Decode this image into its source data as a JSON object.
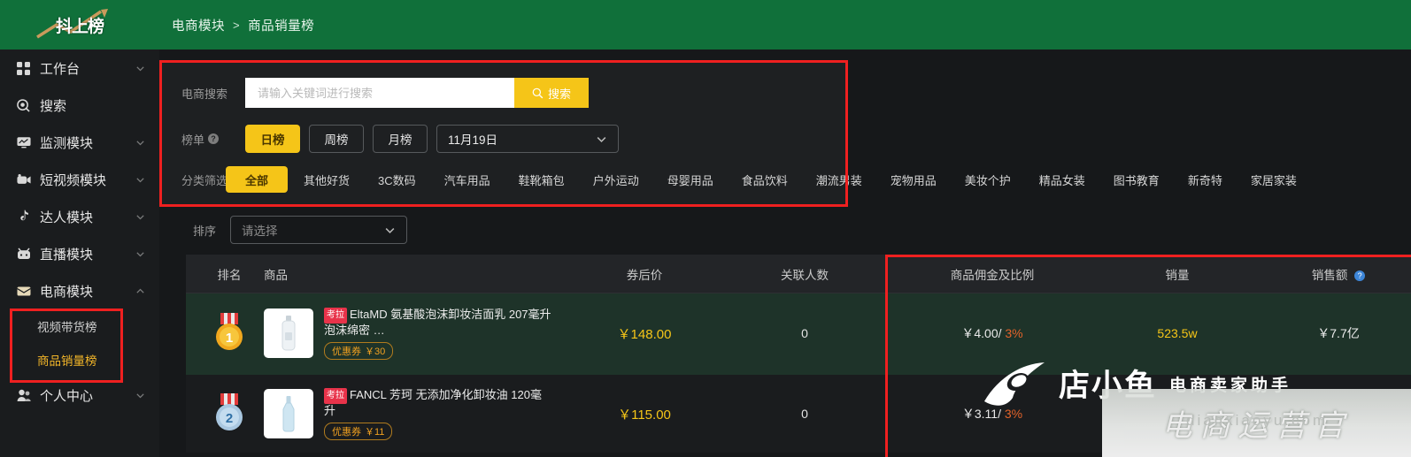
{
  "header": {
    "logo_text": "抖上榜",
    "logo_icon": "rising-arrow-icon",
    "breadcrumb_root": "电商模块",
    "breadcrumb_sep": ">",
    "breadcrumb_current": "商品销量榜"
  },
  "sidebar": {
    "items": [
      {
        "label": "工作台",
        "icon": "grid-icon",
        "chevron": "down"
      },
      {
        "label": "搜索",
        "icon": "search-icon",
        "chevron": ""
      },
      {
        "label": "监测模块",
        "icon": "monitor-icon",
        "chevron": "down"
      },
      {
        "label": "短视频模块",
        "icon": "video-icon",
        "chevron": "down"
      },
      {
        "label": "达人模块",
        "icon": "tiktok-note-icon",
        "chevron": "down"
      },
      {
        "label": "直播模块",
        "icon": "live-icon",
        "chevron": "down"
      },
      {
        "label": "电商模块",
        "icon": "shop-icon",
        "chevron": "up"
      }
    ],
    "sub_items": [
      {
        "label": "视频带货榜",
        "active": false
      },
      {
        "label": "商品销量榜",
        "active": true
      }
    ],
    "footer_item": {
      "label": "个人中心",
      "icon": "user-icon",
      "chevron": "down"
    }
  },
  "filters": {
    "search_label": "电商搜索",
    "search_placeholder": "请输入关键词进行搜索",
    "search_value": "",
    "search_button": "搜索",
    "search_icon": "magnifier-icon",
    "rank_label": "榜单",
    "rank_help_icon": "question-mark-icon",
    "rank_options": [
      {
        "label": "日榜",
        "selected": true
      },
      {
        "label": "周榜",
        "selected": false
      },
      {
        "label": "月榜",
        "selected": false
      }
    ],
    "date_value": "11月19日",
    "date_icon": "chevron-down-icon",
    "category_label": "分类筛选",
    "categories": [
      {
        "label": "全部",
        "selected": true
      },
      {
        "label": "其他好货",
        "selected": false
      },
      {
        "label": "3C数码",
        "selected": false
      },
      {
        "label": "汽车用品",
        "selected": false
      },
      {
        "label": "鞋靴箱包",
        "selected": false
      },
      {
        "label": "户外运动",
        "selected": false
      },
      {
        "label": "母婴用品",
        "selected": false
      },
      {
        "label": "食品饮料",
        "selected": false
      },
      {
        "label": "潮流男装",
        "selected": false
      },
      {
        "label": "宠物用品",
        "selected": false
      },
      {
        "label": "美妆个护",
        "selected": false
      },
      {
        "label": "精品女装",
        "selected": false
      },
      {
        "label": "图书教育",
        "selected": false
      },
      {
        "label": "新奇特",
        "selected": false
      },
      {
        "label": "家居家装",
        "selected": false
      }
    ]
  },
  "sort": {
    "label": "排序",
    "placeholder": "请选择",
    "icon": "chevron-down-icon"
  },
  "table": {
    "columns": [
      "排名",
      "商品",
      "券后价",
      "关联人数",
      "商品佣金及比例",
      "销量",
      "销售额"
    ],
    "sales_help_icon": "question-mark-icon",
    "rows": [
      {
        "rank": "1",
        "medal": "gold-medal-icon",
        "thumb": "product-thumbnail-cleanser",
        "shop_tag": "考拉",
        "title": "EltaMD 氨基酸泡沫卸妆洁面乳 207毫升 泡沫绵密 …",
        "coupon_label": "优惠券",
        "coupon_value": "￥30",
        "price": "￥148.00",
        "people": "0",
        "commission": "￥4.00/",
        "commission_pct": "3%",
        "sales": "523.5w",
        "gmv": "￥7.7亿"
      },
      {
        "rank": "2",
        "medal": "silver-medal-icon",
        "thumb": "product-thumbnail-cleansing-oil",
        "shop_tag": "考拉",
        "title": "FANCL 芳珂 无添加净化卸妆油 120毫升",
        "coupon_label": "优惠券",
        "coupon_value": "￥11",
        "price": "￥115.00",
        "people": "0",
        "commission": "￥3.11/",
        "commission_pct": "3%",
        "sales": "",
        "gmv": ""
      }
    ]
  },
  "watermark": {
    "brand": "店小鱼",
    "tagline": "电商卖家助手",
    "band_text": "电商运营官",
    "band_ghost": "dianxiaoyu.com"
  },
  "colors": {
    "header_green": "#10703a",
    "accent_yellow": "#f5c518",
    "annotation_red": "#ef2020",
    "row_highlight_green": "#1e3329",
    "commission_orange": "#e2632a"
  }
}
